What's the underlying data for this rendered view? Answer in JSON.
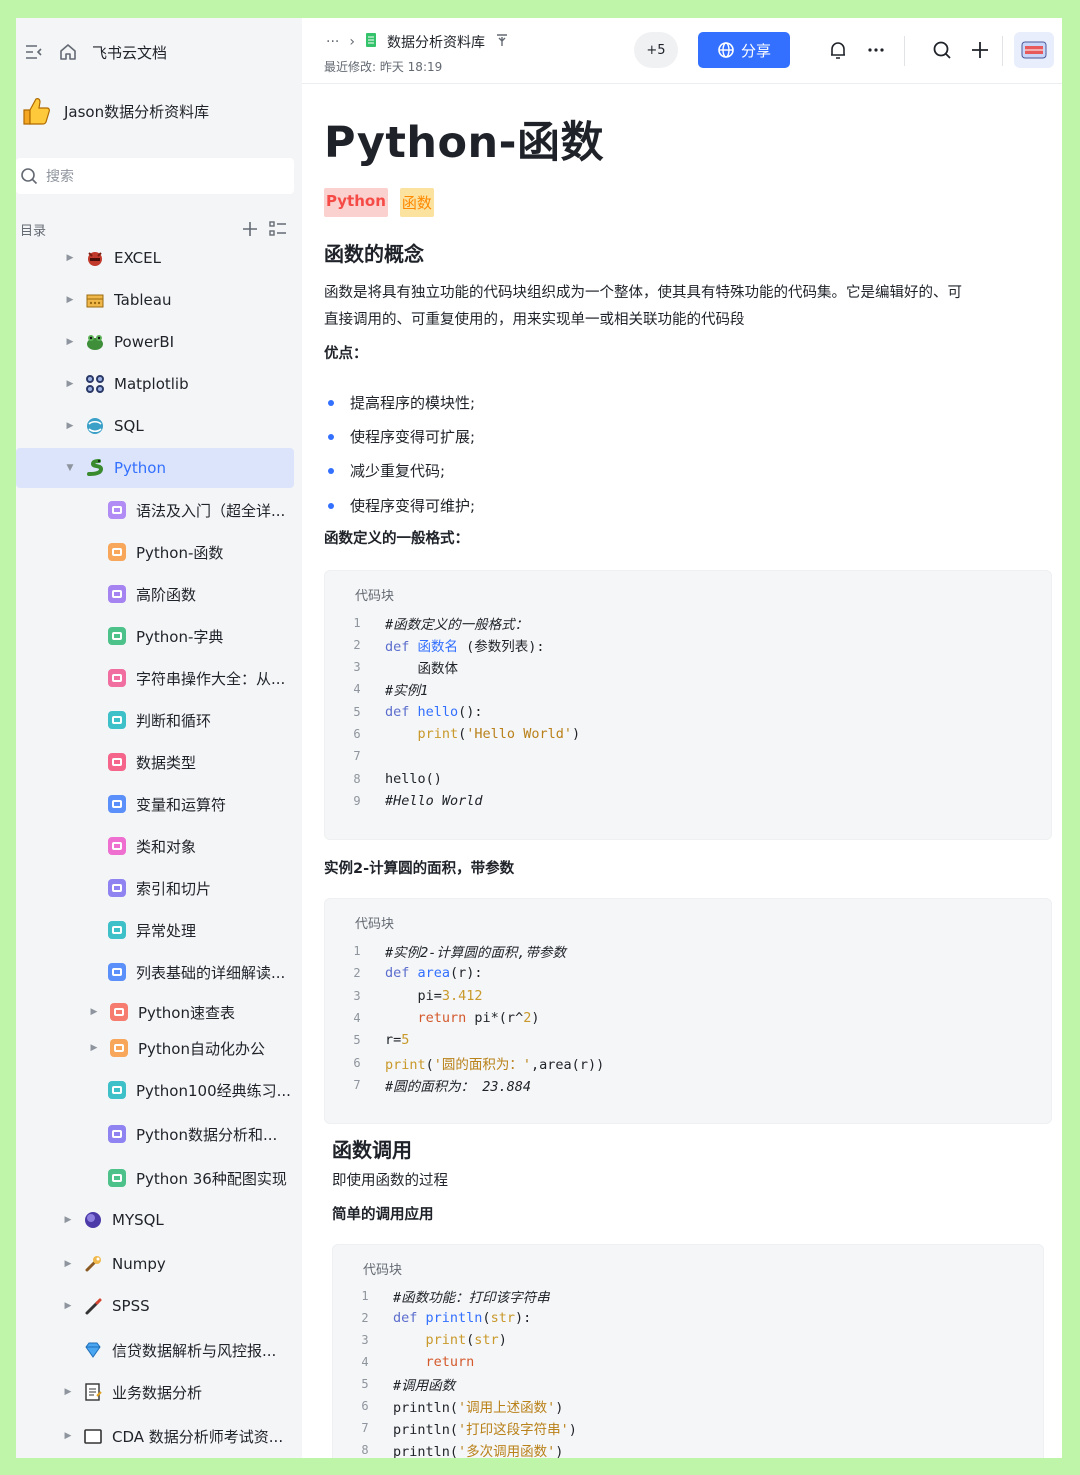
{
  "app": {
    "name": "飞书云文档"
  },
  "space": {
    "name": "Jason数据分析资料库"
  },
  "search": {
    "placeholder": "搜索"
  },
  "toc": {
    "label": "目录"
  },
  "tree": [
    {
      "label": "EXCEL",
      "icon": "devil-icon"
    },
    {
      "label": "Tableau",
      "icon": "box-icon"
    },
    {
      "label": "PowerBI",
      "icon": "frog-icon"
    },
    {
      "label": "Matplotlib",
      "icon": "plot-icon"
    },
    {
      "label": "SQL",
      "icon": "database-icon"
    },
    {
      "label": "Python",
      "icon": "snake-icon"
    },
    {
      "label": "语法及入门（超全详...",
      "icon": "doc-icon"
    },
    {
      "label": "Python-函数",
      "icon": "doc-icon"
    },
    {
      "label": "高阶函数",
      "icon": "doc-icon"
    },
    {
      "label": "Python-字典",
      "icon": "doc-icon"
    },
    {
      "label": "字符串操作大全：从...",
      "icon": "doc-icon"
    },
    {
      "label": "判断和循环",
      "icon": "doc-icon"
    },
    {
      "label": "数据类型",
      "icon": "doc-icon"
    },
    {
      "label": "变量和运算符",
      "icon": "doc-icon"
    },
    {
      "label": "类和对象",
      "icon": "doc-icon"
    },
    {
      "label": "索引和切片",
      "icon": "doc-icon"
    },
    {
      "label": "异常处理",
      "icon": "doc-icon"
    },
    {
      "label": "列表基础的详细解读...",
      "icon": "doc-icon"
    },
    {
      "label": "Python速查表",
      "icon": "doc-icon"
    },
    {
      "label": "Python自动化办公",
      "icon": "doc-icon"
    },
    {
      "label": "Python100经典练习...",
      "icon": "doc-icon"
    },
    {
      "label": "Python数据分析和...",
      "icon": "doc-icon"
    },
    {
      "label": "Python 36种配图实现",
      "icon": "doc-icon"
    },
    {
      "label": "MYSQL",
      "icon": "dolphin-icon"
    },
    {
      "label": "Numpy",
      "icon": "wrench-icon"
    },
    {
      "label": "SPSS",
      "icon": "pen-icon"
    },
    {
      "label": "信贷数据解析与风控报...",
      "icon": "diamond-icon"
    },
    {
      "label": "业务数据分析",
      "icon": "memo-icon"
    },
    {
      "label": "CDA 数据分析师考试资...",
      "icon": "folder-icon"
    }
  ],
  "colors": {
    "accent": "#3370ff",
    "tag_red": "#f54a45",
    "tag_yellow": "#ff8800"
  },
  "header": {
    "breadcrumb_more": "···",
    "breadcrumb": "数据分析资料库",
    "modified": "最近修改: 昨天 18:19",
    "collaborators": "+5",
    "share_label": "分享"
  },
  "doc": {
    "title": "Python-函数",
    "tags": [
      "Python",
      "函数"
    ],
    "h_concept": "函数的概念",
    "concept_line1": "函数是将具有独立功能的代码块组织成为一个整体，使其具有特殊功能的代码集。它是编辑好的、可",
    "concept_line2": "直接调用的、可重复使用的，用来实现单一或相关联功能的代码段",
    "advantages_label": "优点：",
    "advantages": [
      "提高程序的模块性;",
      "使程序变得可扩展;",
      "减少重复代码;",
      "使程序变得可维护;"
    ],
    "format_label": "函数定义的一般格式：",
    "code_label": "代码块",
    "code1": {
      "lines": [
        "#函数定义的一般格式：",
        "def 函数名 (参数列表):",
        "    函数体",
        "#实例1",
        "def hello():",
        "    print('Hello World')",
        "",
        "hello()",
        "#Hello World"
      ],
      "nums": [
        "1",
        "2",
        "3",
        "4",
        "5",
        "6",
        "7",
        "8",
        "9"
      ]
    },
    "example2_label": "实例2-计算圆的面积，带参数",
    "code2": {
      "lines": [
        "#实例2-计算圆的面积,带参数",
        "def area(r):",
        "    pi=3.412",
        "    return pi*(r^2)",
        "r=5",
        "print('圆的面积为：',area(r))",
        "#圆的面积为： 23.884"
      ],
      "nums": [
        "1",
        "2",
        "3",
        "4",
        "5",
        "6",
        "7"
      ]
    },
    "h_call": "函数调用",
    "call_desc": "即使用函数的过程",
    "simple_call_label": "简单的调用应用",
    "code3": {
      "lines": [
        "#函数功能：打印该字符串",
        "def println(str):",
        "    print(str)",
        "    return",
        "#调用函数",
        "println('调用上述函数')",
        "println('打印这段字符串')",
        "println('多次调用函数')"
      ],
      "nums": [
        "1",
        "2",
        "3",
        "4",
        "5",
        "6",
        "7",
        "8"
      ]
    }
  }
}
